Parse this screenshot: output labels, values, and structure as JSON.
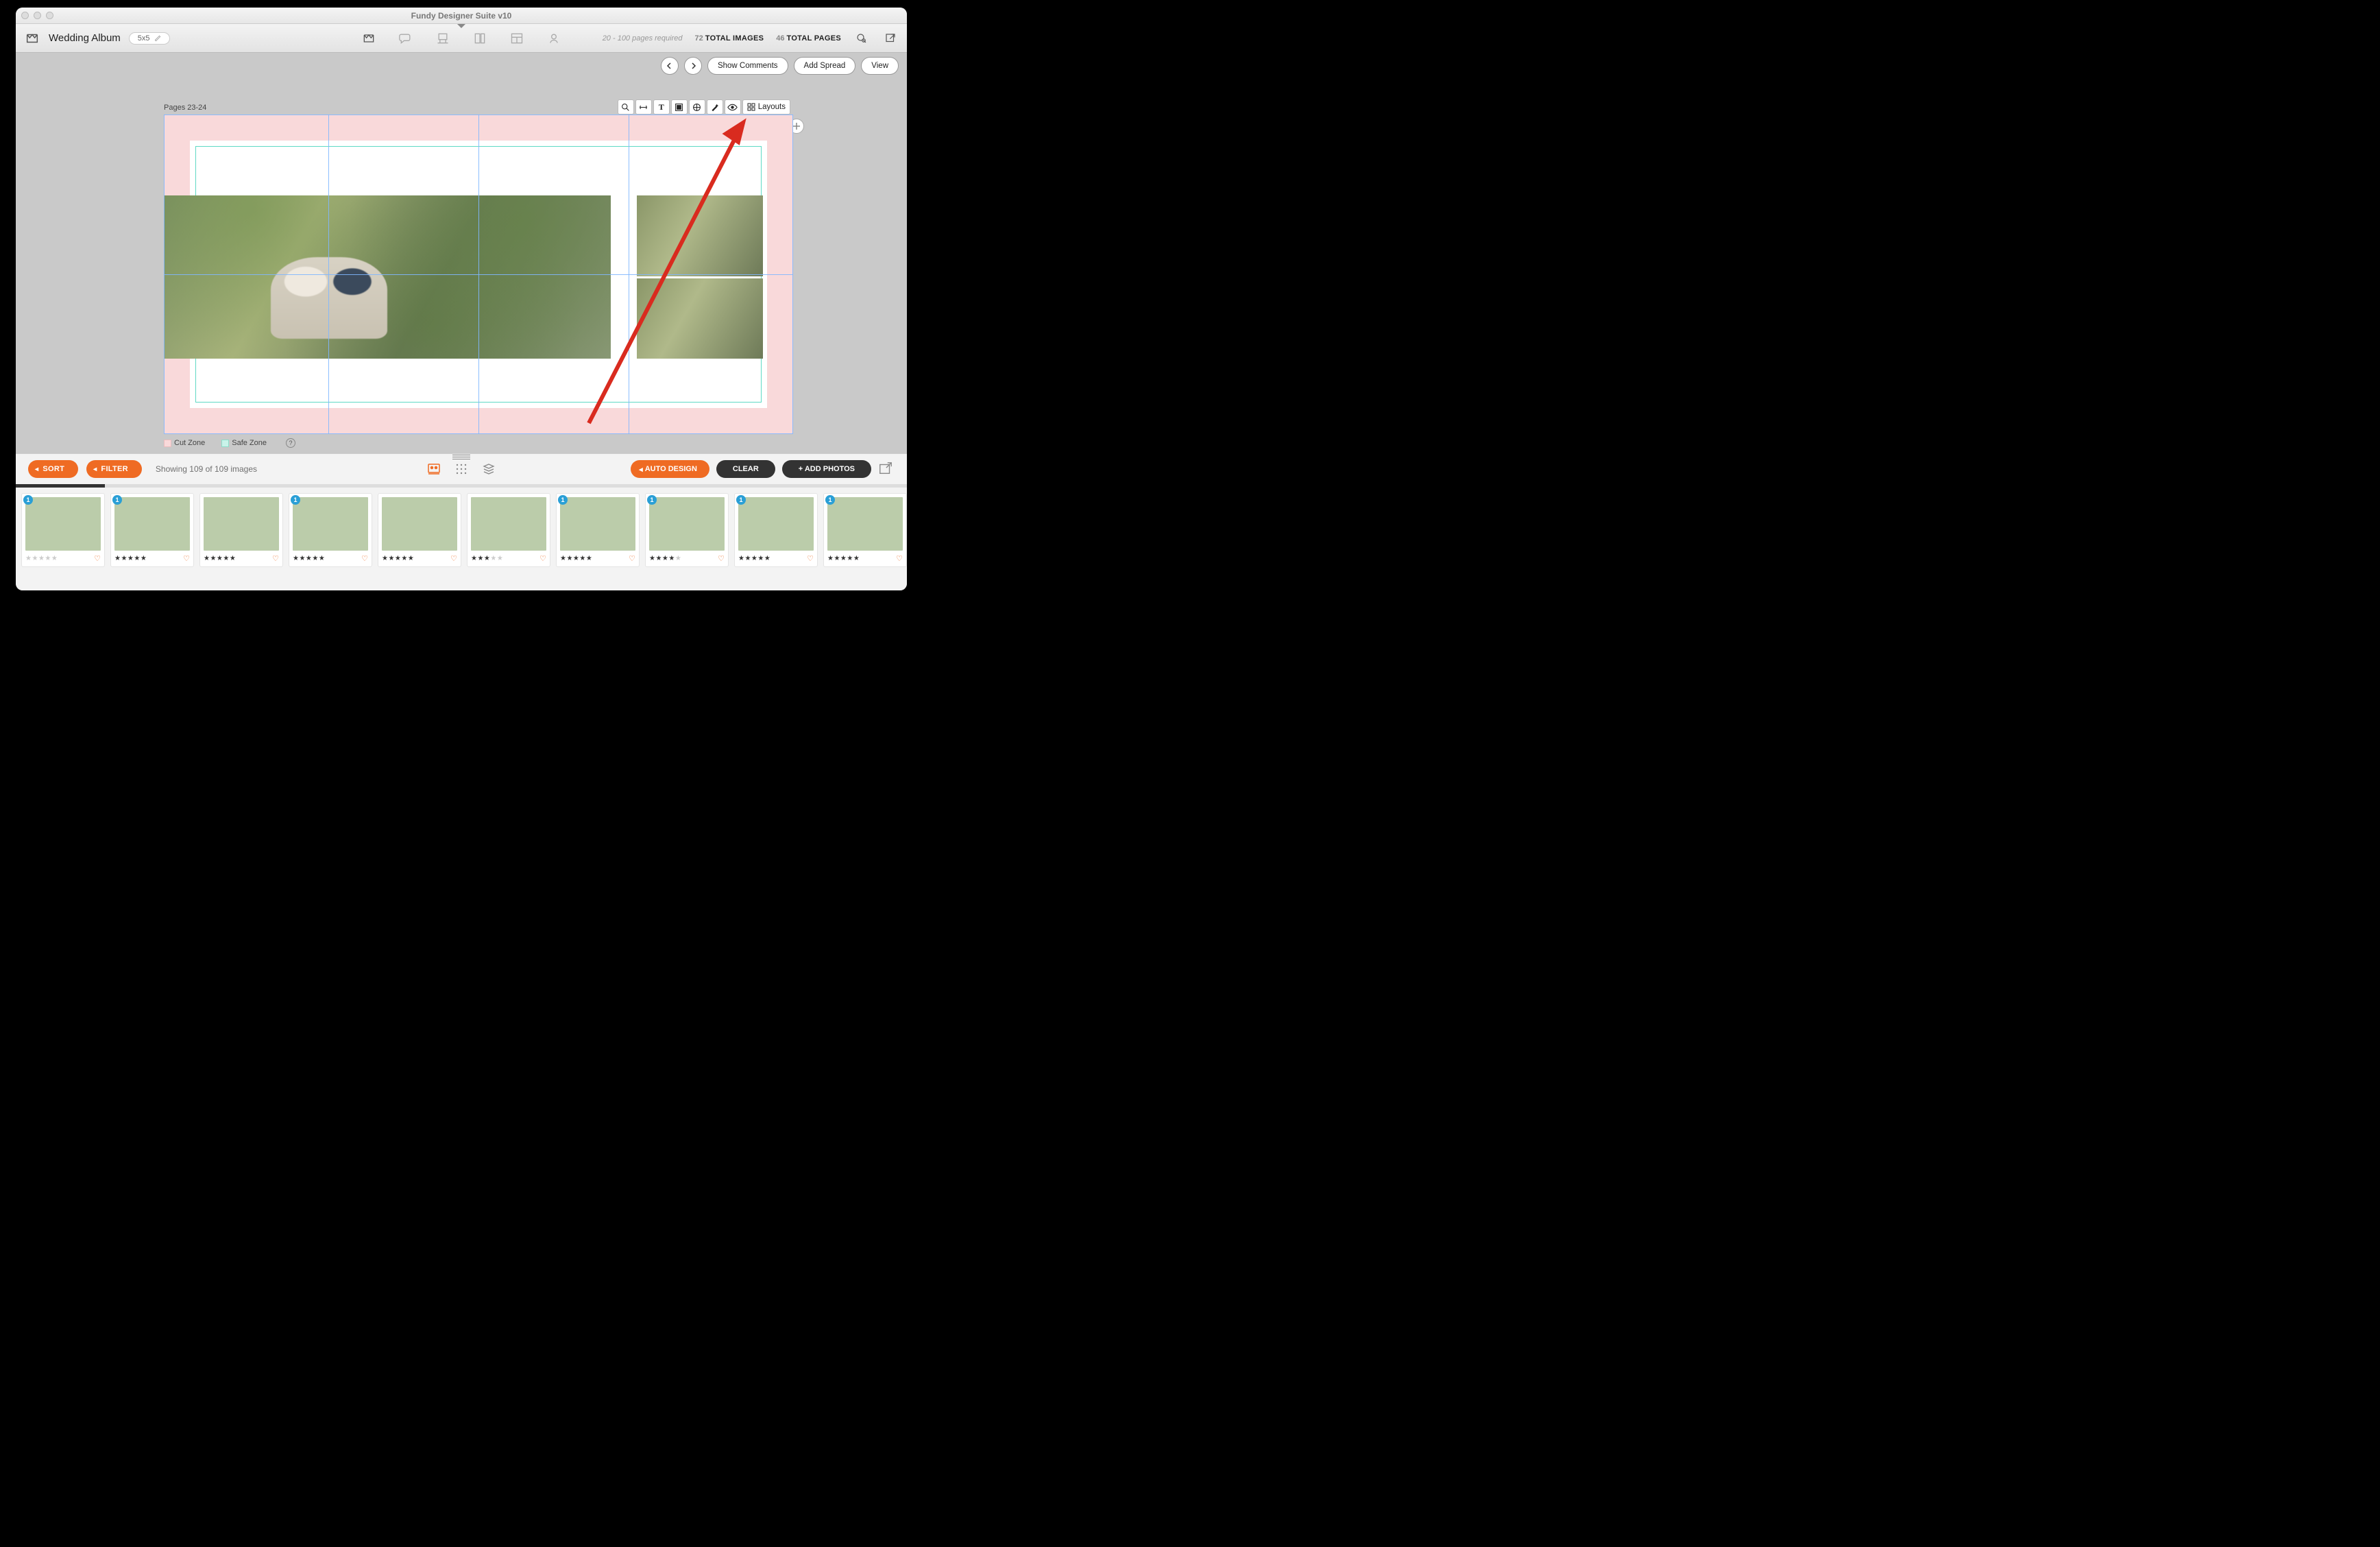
{
  "app": {
    "title": "Fundy Designer Suite v10"
  },
  "header": {
    "doc_title": "Wedding Album",
    "size_chip": "5x5",
    "pages_req": "20 - 100 pages required",
    "stats": [
      {
        "num": "72",
        "label": "TOTAL IMAGES"
      },
      {
        "num": "46",
        "label": "TOTAL PAGES"
      }
    ]
  },
  "subbar": {
    "show_comments": "Show Comments",
    "add_spread": "Add Spread",
    "view": "View"
  },
  "canvas": {
    "page_label": "Pages 23-24",
    "layouts_label": "Layouts",
    "legend_cut": "Cut Zone",
    "legend_safe": "Safe Zone"
  },
  "bottom": {
    "sort": "SORT",
    "filter": "FILTER",
    "showing": "Showing 109 of 109 images",
    "auto": "AUTO DESIGN",
    "clear": "CLEAR",
    "add": "+ ADD PHOTOS"
  },
  "thumbs": [
    {
      "badge": "1",
      "rating": 0,
      "cls": "t0"
    },
    {
      "badge": "1",
      "rating": 5,
      "cls": "t1"
    },
    {
      "badge": "",
      "rating": 5,
      "cls": "t2"
    },
    {
      "badge": "1",
      "rating": 5,
      "cls": "t3"
    },
    {
      "badge": "",
      "rating": 5,
      "cls": "t4"
    },
    {
      "badge": "",
      "rating": 3,
      "cls": "t5"
    },
    {
      "badge": "1",
      "rating": 5,
      "cls": "t6"
    },
    {
      "badge": "1",
      "rating": 4,
      "cls": "t7"
    },
    {
      "badge": "1",
      "rating": 5,
      "cls": "t8"
    },
    {
      "badge": "1",
      "rating": 5,
      "cls": "t9"
    }
  ]
}
